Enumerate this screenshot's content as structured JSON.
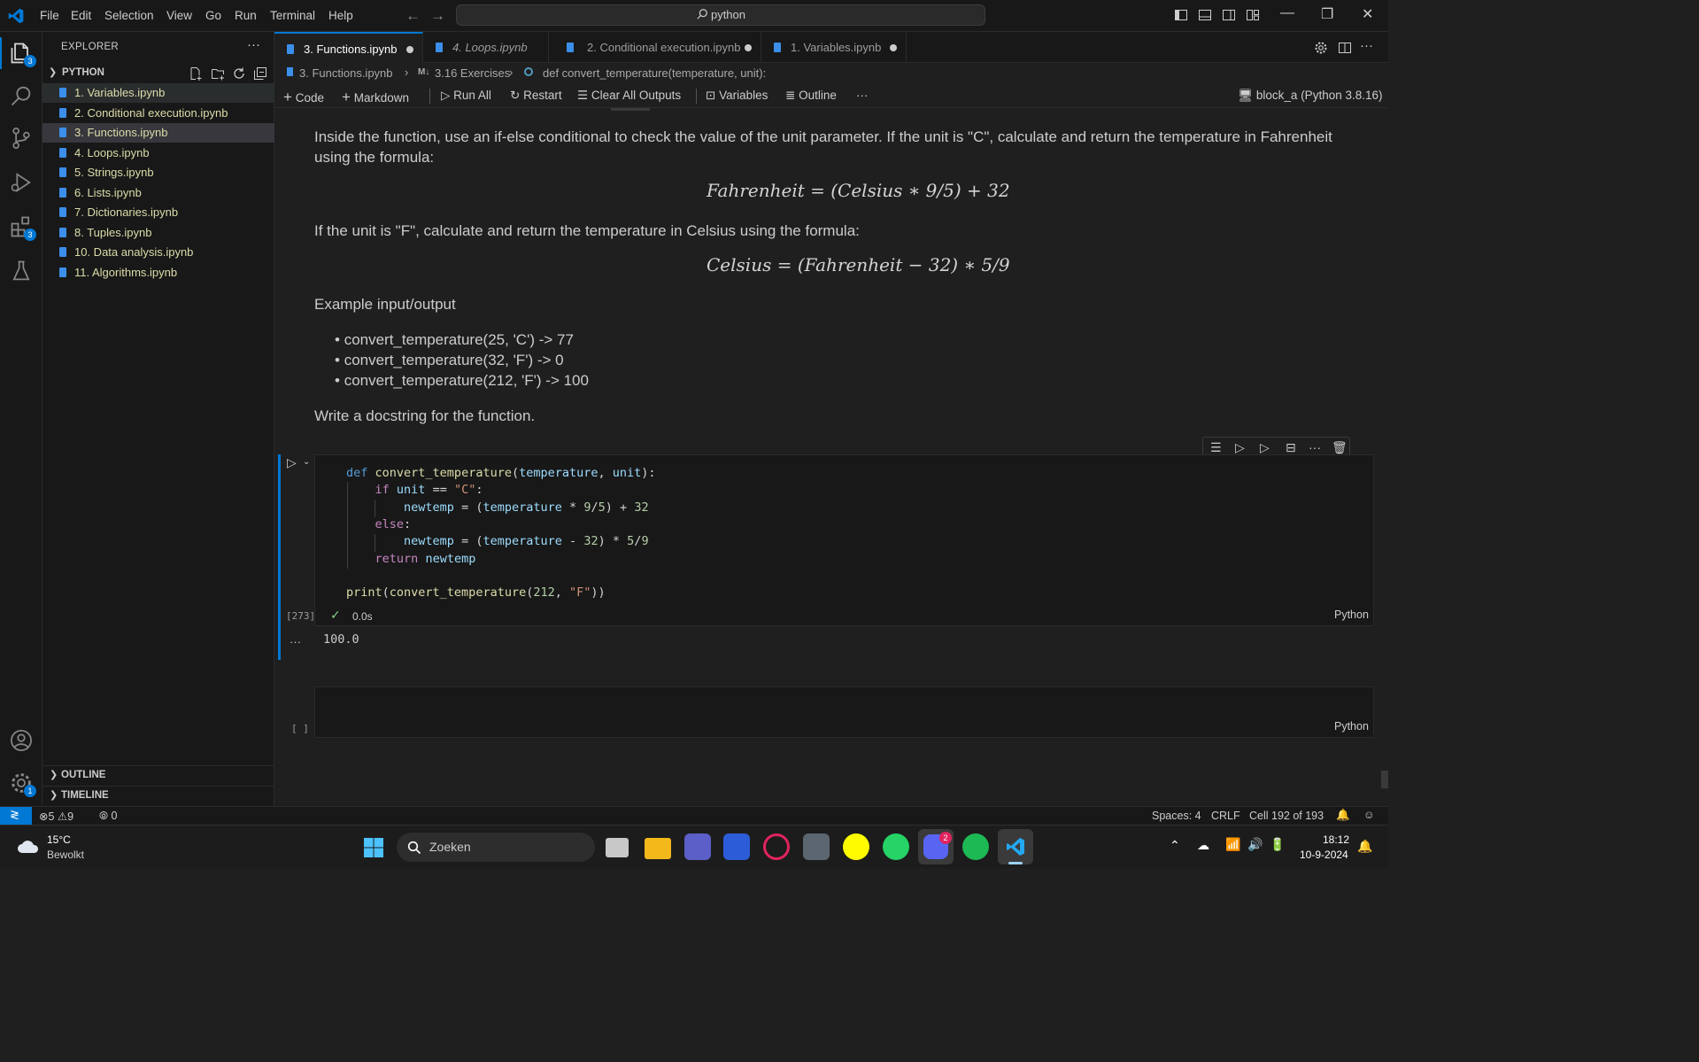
{
  "menu": [
    "File",
    "Edit",
    "Selection",
    "View",
    "Go",
    "Run",
    "Terminal",
    "Help"
  ],
  "search": {
    "text": "python"
  },
  "activity": {
    "explorer_badge": "3",
    "extensions_badge": "3",
    "settings_badge": "1"
  },
  "sidebar": {
    "title": "EXPLORER",
    "folder": "PYTHON",
    "files": [
      "1. Variables.ipynb",
      "2. Conditional execution.ipynb",
      "3. Functions.ipynb",
      "4. Loops.ipynb",
      "5. Strings.ipynb",
      "6. Lists.ipynb",
      "7. Dictionaries.ipynb",
      "8. Tuples.ipynb",
      "10. Data analysis.ipynb",
      "11. Algorithms.ipynb"
    ],
    "outline": "OUTLINE",
    "timeline": "TIMELINE"
  },
  "tabs": [
    {
      "label": "3. Functions.ipynb"
    },
    {
      "label": "4. Loops.ipynb"
    },
    {
      "label": "2. Conditional execution.ipynb"
    },
    {
      "label": "1. Variables.ipynb"
    }
  ],
  "breadcrumb": {
    "file": "3. Functions.ipynb",
    "section_icon": "M↓",
    "section": "3.16 Exercises",
    "symbol": "def convert_temperature(temperature, unit):"
  },
  "toolbar": {
    "code": "Code",
    "markdown": "Markdown",
    "run_all": "Run All",
    "restart": "Restart",
    "clear": "Clear All Outputs",
    "variables": "Variables",
    "outline": "Outline",
    "more": "···",
    "kernel": "block_a (Python 3.8.16)"
  },
  "markdown": {
    "p1_line1": "Inside the function, use an if-else conditional to check the value of the unit parameter. If the unit is \"C\", calculate and return the temperature in Fahrenheit",
    "p1_line2": "using the formula:",
    "formula1": "Fahrenheit = (Celsius ∗ 9/5) + 32",
    "p2": "If the unit is \"F\", calculate and return the temperature in Celsius using the formula:",
    "formula2": "Celsius = (Fahrenheit − 32) ∗ 5/9",
    "example_title": "Example input/output",
    "examples": [
      "convert_temperature(25, 'C') -> 77",
      "convert_temperature(32, 'F') -> 0",
      "convert_temperature(212, 'F') -> 100"
    ],
    "docstring": "Write a docstring for the function."
  },
  "code_cell": {
    "exec_count": "[273]",
    "time": "0.0s",
    "lang": "Python"
  },
  "output": {
    "ellipsis": "···",
    "value": "100.0"
  },
  "empty_cell": {
    "exec_count": "[ ]",
    "lang": "Python"
  },
  "status": {
    "errors": "5",
    "warnings": "9",
    "ports": "0",
    "spaces": "Spaces: 4",
    "eol": "CRLF",
    "cell": "Cell 192 of 193"
  },
  "taskbar": {
    "temp": "15°C",
    "weather": "Bewolkt",
    "search": "Zoeken",
    "time": "18:12",
    "date": "10-9-2024",
    "discord_badge": "2"
  },
  "colors": {
    "accent": "#0078d4",
    "keyword": "#569cd6",
    "control": "#c586c0",
    "function": "#dcdcaa",
    "variable": "#9cdcfe",
    "string": "#ce9178",
    "number": "#b5cea8"
  }
}
